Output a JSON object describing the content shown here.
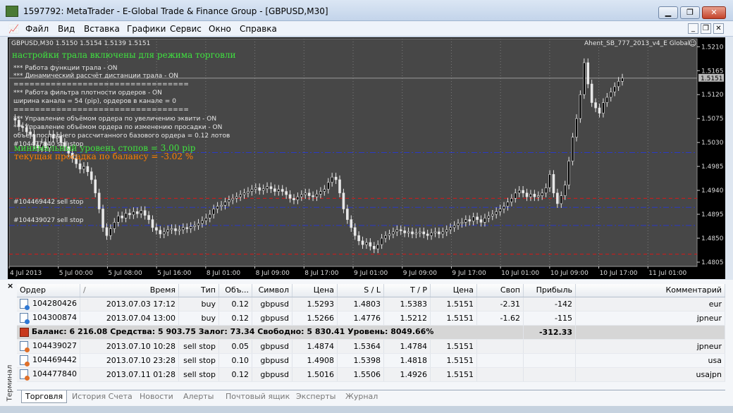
{
  "window": {
    "title": "1597792: MetaTrader - E-Global Trade & Finance Group - [GBPUSD,M30]",
    "minimize": "▁",
    "restore": "❐",
    "close": "✕"
  },
  "menu": [
    "Файл",
    "Вид",
    "Вставка",
    "Графики",
    "Сервис",
    "Окно",
    "Справка"
  ],
  "mdi": [
    "_",
    "❐",
    "✕"
  ],
  "chart": {
    "header": "GBPUSD,M30  1.5150 1.5154 1.5139 1.5151",
    "expert": "Ahent_SB_777_2013_v4_E Global",
    "bid_label": "1.5151",
    "overlay": {
      "line_green": "настройки трала включены для режима  торговли",
      "line1": "*** Работа функции трала -    ON",
      "line2": "*** Динамический рассчёт дистанции трала -    ON",
      "sep": "=================================",
      "line3": "*** Работа фильтра плотности ордеров -    ON",
      "line4": "ширина канала = 54 (pip), ордеров в канале =  0",
      "line5": "*** Управление объёмом ордера по увеличению эквити -    ON",
      "line6": "*** Управление объёмом ордера по изменению просадки -    ON",
      "line7": "объём последнего рассчитанного базового ордера =  0.12 лотов",
      "order_tag": "#104477840  sell stop",
      "min_level": "минимальный уровень  стопов = 3.00 pip",
      "drawdown": "текущая просадка по балансу = -3.02 %",
      "sellstop1": "#104469442 sell stop",
      "sellstop2": "#104439027 sell stop"
    }
  },
  "chart_data": {
    "type": "candlestick",
    "title": "GBPUSD,M30",
    "ohlc_header": {
      "open": 1.515,
      "high": 1.5154,
      "low": 1.5139,
      "close": 1.5151
    },
    "y_ticks": [
      "1.5210",
      "1.5165",
      "1.5120",
      "1.5075",
      "1.5030",
      "1.4985",
      "1.4940",
      "1.4895",
      "1.4850",
      "1.4805"
    ],
    "x_ticks": [
      "4 Jul 2013",
      "5 Jul 00:00",
      "5 Jul 08:00",
      "5 Jul 16:00",
      "8 Jul 01:00",
      "8 Jul 09:00",
      "8 Jul 17:00",
      "9 Jul 01:00",
      "9 Jul 09:00",
      "9 Jul 17:00",
      "10 Jul 01:00",
      "10 Jul 09:00",
      "10 Jul 17:00",
      "11 Jul 01:00"
    ],
    "ylim": [
      1.4797,
      1.5225
    ],
    "price_path": [
      1.5075,
      1.5072,
      1.506,
      1.5058,
      1.505,
      1.5045,
      1.5025,
      1.502,
      1.503,
      1.502,
      1.5045,
      1.5038,
      1.5042,
      1.503,
      1.5022,
      1.501,
      1.5,
      1.499,
      1.498,
      1.4985,
      1.4975,
      1.496,
      1.4935,
      1.4905,
      1.487,
      1.4855,
      1.4868,
      1.488,
      1.4892,
      1.4888,
      1.4897,
      1.4894,
      1.49,
      1.4896,
      1.4902,
      1.4893,
      1.4885,
      1.487,
      1.4865,
      1.4858,
      1.4862,
      1.4866,
      1.4868,
      1.4864,
      1.4866,
      1.487,
      1.4868,
      1.4872,
      1.4874,
      1.4878,
      1.4883,
      1.4888,
      1.4895,
      1.4905,
      1.491,
      1.4912,
      1.4918,
      1.4922,
      1.4925,
      1.4928,
      1.4932,
      1.4935,
      1.4938,
      1.4942,
      1.4945,
      1.494,
      1.4943,
      1.4947,
      1.4943,
      1.4938,
      1.4942,
      1.4938,
      1.4932,
      1.4925,
      1.4922,
      1.4928,
      1.4932,
      1.4935,
      1.493,
      1.4928,
      1.4933,
      1.4938,
      1.4942,
      1.4955,
      1.4965,
      1.496,
      1.4935,
      1.4905,
      1.4885,
      1.487,
      1.4855,
      1.4845,
      1.4838,
      1.4842,
      1.4835,
      1.483,
      1.4838,
      1.485,
      1.4855,
      1.4858,
      1.4862,
      1.4866,
      1.4864,
      1.486,
      1.4862,
      1.4858,
      1.486,
      1.4862,
      1.4858,
      1.4855,
      1.486,
      1.4862,
      1.4858,
      1.4862,
      1.4866,
      1.487,
      1.4874,
      1.4878,
      1.488,
      1.4885,
      1.4882,
      1.489,
      1.4885,
      1.488,
      1.4888,
      1.4892,
      1.4895,
      1.49,
      1.4905,
      1.491,
      1.4918,
      1.4925,
      1.4935,
      1.494,
      1.4935,
      1.4928,
      1.4933,
      1.4928,
      1.493,
      1.4935,
      1.4945,
      1.497,
      1.4935,
      1.4915,
      1.493,
      1.495,
      1.4995,
      1.504,
      1.5075,
      1.512,
      1.518,
      1.514,
      1.5105,
      1.5095,
      1.5085,
      1.5105,
      1.5115,
      1.5125,
      1.5135,
      1.5145,
      1.5151
    ],
    "levels": {
      "bid": 1.5151,
      "min_stop_line": 1.5011,
      "sell_stop_1": 1.4908,
      "sell_stop_2": 1.4874,
      "red_dash_top": 1.4925,
      "red_dash_low": 1.482
    },
    "series": [
      {
        "name": "GBPUSD,M30",
        "values": []
      }
    ]
  },
  "terminal": {
    "close_glyph": "×",
    "side_label": "Терминал",
    "columns": [
      "Ордер",
      "/",
      "Время",
      "Тип",
      "Объ...",
      "Символ",
      "Цена",
      "S / L",
      "T / P",
      "Цена",
      "Своп",
      "Прибыль",
      "Комментарий"
    ],
    "rows": [
      {
        "order": "104280426",
        "time": "2013.07.03 17:12",
        "type": "buy",
        "volume": "0.12",
        "symbol": "gbpusd",
        "price": "1.5293",
        "sl": "1.4803",
        "tp": "1.5383",
        "cur": "1.5151",
        "swap": "-2.31",
        "profit": "-142",
        "comment": "eur",
        "pending": false
      },
      {
        "order": "104300874",
        "time": "2013.07.04 13:00",
        "type": "buy",
        "volume": "0.12",
        "symbol": "gbpusd",
        "price": "1.5266",
        "sl": "1.4776",
        "tp": "1.5212",
        "cur": "1.5151",
        "swap": "-1.62",
        "profit": "-115",
        "comment": "jpneur",
        "pending": false
      }
    ],
    "summary": {
      "text": "Баланс: 6 216.08  Средства: 5 903.75  Залог: 73.34  Свободно: 5 830.41  Уровень: 8049.66%",
      "profit": "-312.33"
    },
    "pending_rows": [
      {
        "order": "104439027",
        "time": "2013.07.10 10:28",
        "type": "sell stop",
        "volume": "0.05",
        "symbol": "gbpusd",
        "price": "1.4874",
        "sl": "1.5364",
        "tp": "1.4784",
        "cur": "1.5151",
        "comment": "jpneur"
      },
      {
        "order": "104469442",
        "time": "2013.07.10 23:28",
        "type": "sell stop",
        "volume": "0.10",
        "symbol": "gbpusd",
        "price": "1.4908",
        "sl": "1.5398",
        "tp": "1.4818",
        "cur": "1.5151",
        "comment": "usa"
      },
      {
        "order": "104477840",
        "time": "2013.07.11 01:28",
        "type": "sell stop",
        "volume": "0.12",
        "symbol": "gbpusd",
        "price": "1.5016",
        "sl": "1.5506",
        "tp": "1.4926",
        "cur": "1.5151",
        "comment": "usajpn"
      }
    ],
    "tabs": [
      "Торговля",
      "История Счета",
      "Новости",
      "Алерты",
      "Почтовый ящик",
      "Эксперты",
      "Журнал"
    ]
  },
  "colors": {
    "chart_bg": "#000000",
    "plot_bg": "#474747",
    "candle": "#e8e8e8",
    "green": "#2ecc2e",
    "red": "#d81818",
    "yellow": "#e6e600",
    "blue_line": "#2a3ac6"
  }
}
